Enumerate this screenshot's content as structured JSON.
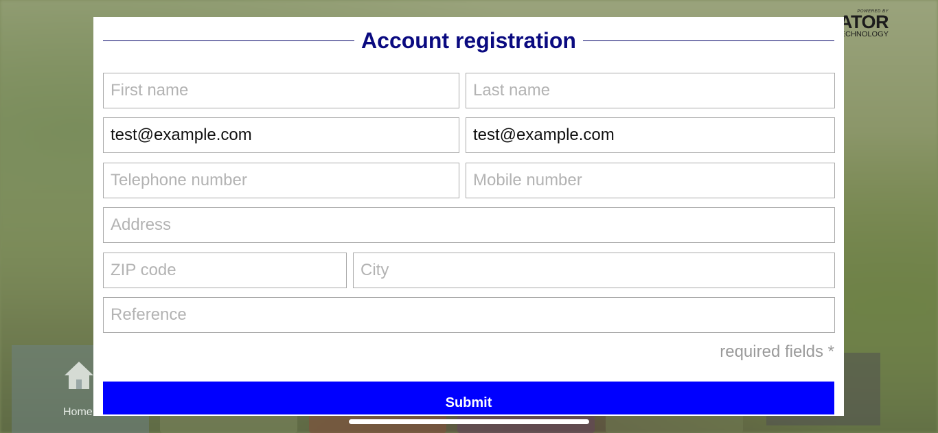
{
  "background": {
    "logo": {
      "powered_by": "POWERED BY",
      "brand": "ATOR",
      "tagline": "ECHNOLOGY"
    },
    "home_label": "Home"
  },
  "form": {
    "title": "Account registration",
    "fields": {
      "first_name": {
        "placeholder": "First name",
        "value": ""
      },
      "last_name": {
        "placeholder": "Last name",
        "value": ""
      },
      "email": {
        "placeholder": "",
        "value": "test@example.com"
      },
      "email_confirm": {
        "placeholder": "",
        "value": "test@example.com"
      },
      "telephone": {
        "placeholder": "Telephone number",
        "value": ""
      },
      "mobile": {
        "placeholder": "Mobile number",
        "value": ""
      },
      "address": {
        "placeholder": "Address",
        "value": ""
      },
      "zip": {
        "placeholder": "ZIP code",
        "value": ""
      },
      "city": {
        "placeholder": "City",
        "value": ""
      },
      "reference": {
        "placeholder": "Reference",
        "value": ""
      }
    },
    "required_note": "required fields *",
    "submit_label": "Submit"
  },
  "colors": {
    "title": "#0a0a80",
    "submit_bg": "#0000ff",
    "field_border": "#a9a9a9"
  }
}
